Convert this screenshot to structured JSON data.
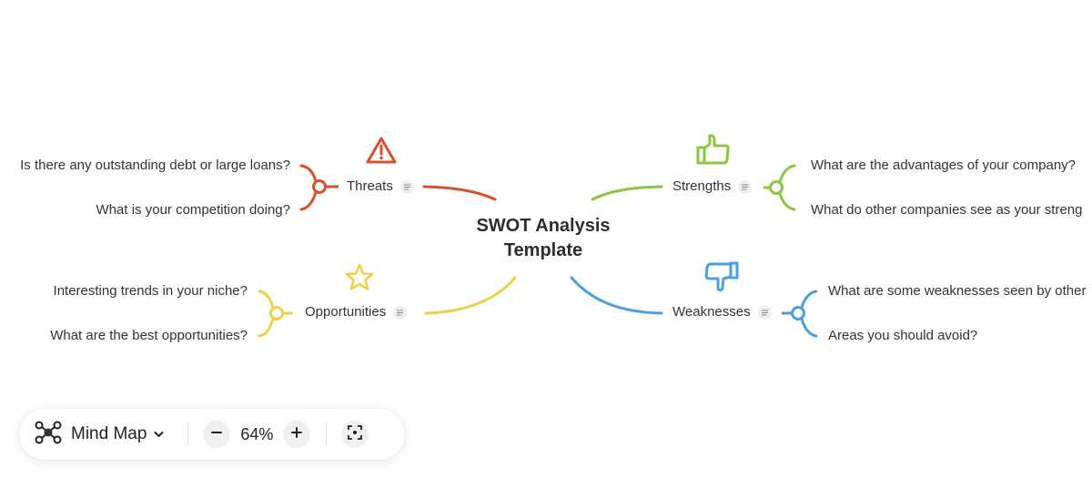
{
  "central_topic": {
    "line1": "SWOT Analysis",
    "line2": "Template"
  },
  "branches": {
    "threats": {
      "label": "Threats",
      "icon": "warning-triangle-icon",
      "color": "#d9502f",
      "children": [
        "Is there any outstanding debt or large loans?",
        "What is your competition doing?"
      ]
    },
    "strengths": {
      "label": "Strengths",
      "icon": "thumbs-up-icon",
      "color": "#8cc63f",
      "children": [
        "What are the advantages of your company?",
        "What do other companies see as your streng"
      ]
    },
    "opportunities": {
      "label": "Opportunities",
      "icon": "star-icon",
      "color": "#ecd14a",
      "children": [
        "Interesting trends in your niche?",
        "What are the best opportunities?"
      ]
    },
    "weaknesses": {
      "label": "Weaknesses",
      "icon": "thumbs-down-icon",
      "color": "#4a9fe0",
      "children": [
        "What are some weaknesses seen by other",
        "Areas you should avoid?"
      ]
    }
  },
  "toolbar": {
    "mode_icon": "mind-map-icon",
    "mode_label": "Mind Map",
    "zoom_out_icon": "minus-icon",
    "zoom_level": "64%",
    "zoom_in_icon": "plus-icon",
    "fit_icon": "focus-center-icon"
  }
}
